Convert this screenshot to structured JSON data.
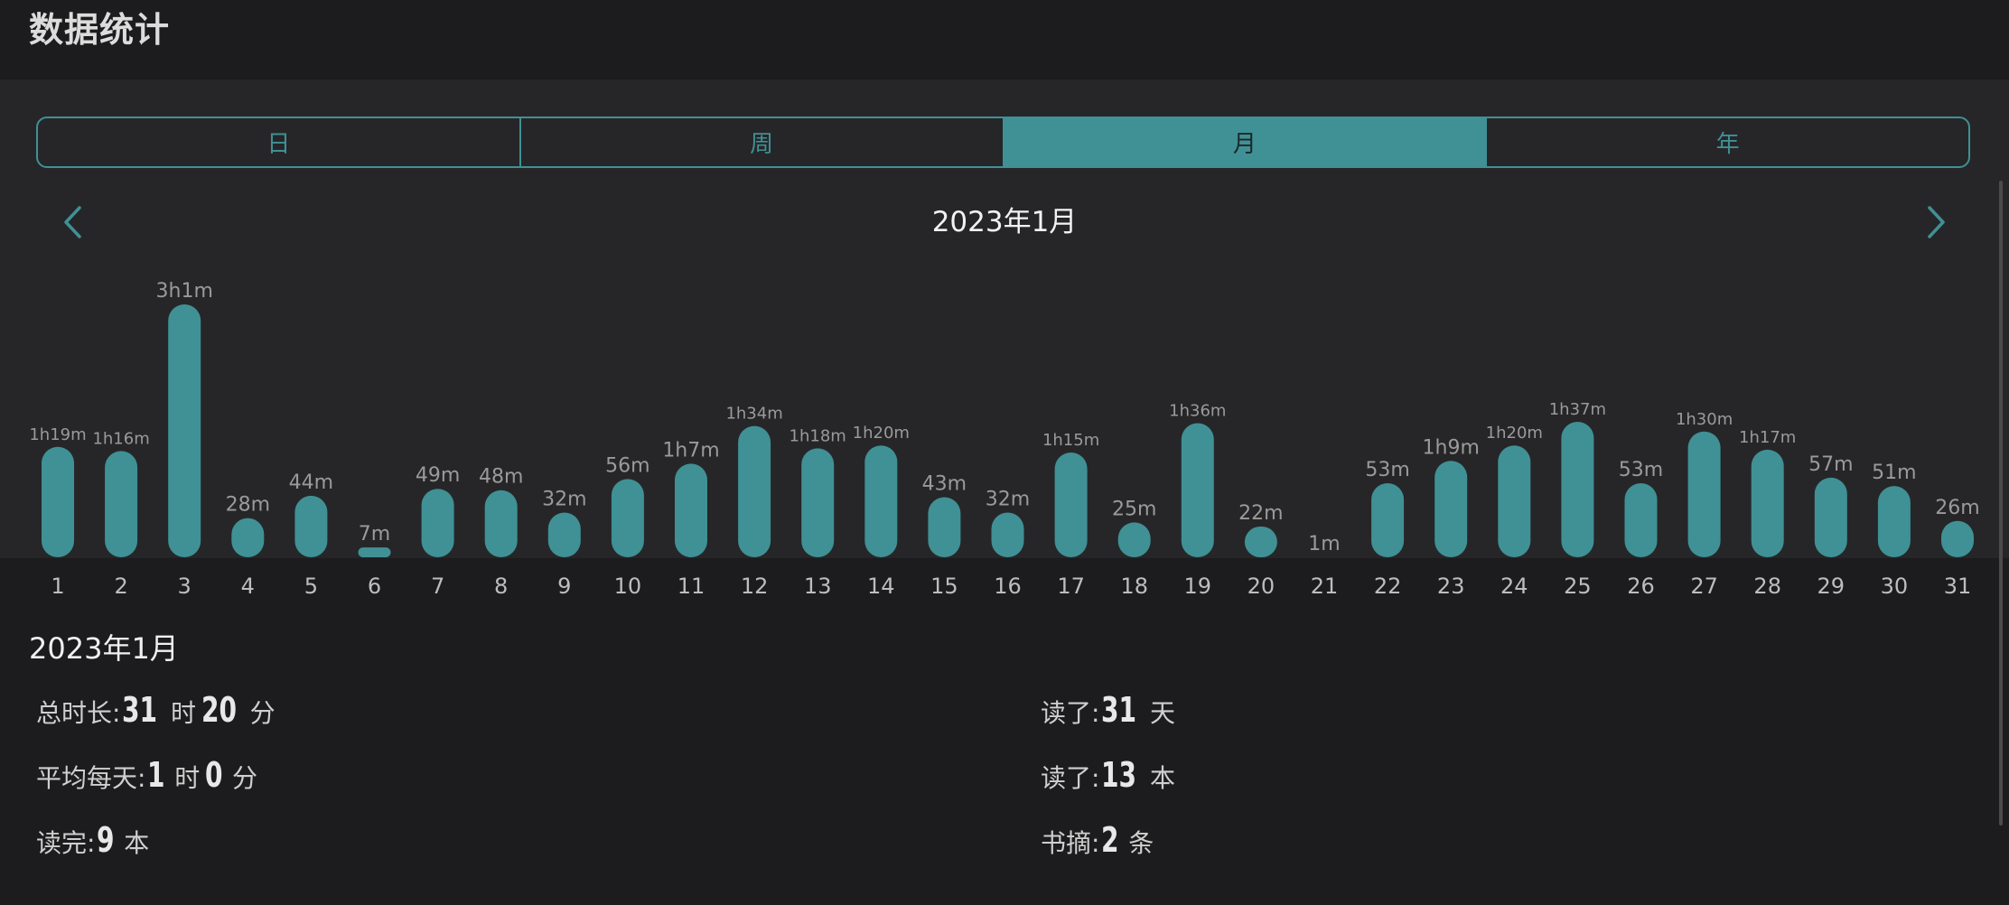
{
  "page_title": "数据统计",
  "tabs": [
    {
      "label": "日",
      "active": false
    },
    {
      "label": "周",
      "active": false
    },
    {
      "label": "月",
      "active": true
    },
    {
      "label": "年",
      "active": false
    }
  ],
  "period_label": "2023年1月",
  "nav": {
    "prev_icon": "chevron-left-icon",
    "next_icon": "chevron-right-icon"
  },
  "colors": {
    "accent": "#3f9195",
    "bar": "#3f9195",
    "background": "#1c1c1e",
    "panel": "#262628"
  },
  "chart_data": {
    "type": "bar",
    "categories": [
      "1",
      "2",
      "3",
      "4",
      "5",
      "6",
      "7",
      "8",
      "9",
      "10",
      "11",
      "12",
      "13",
      "14",
      "15",
      "16",
      "17",
      "18",
      "19",
      "20",
      "21",
      "22",
      "23",
      "24",
      "25",
      "26",
      "27",
      "28",
      "29",
      "30",
      "31"
    ],
    "values_minutes": [
      79,
      76,
      181,
      28,
      44,
      7,
      49,
      48,
      32,
      56,
      67,
      94,
      78,
      80,
      43,
      32,
      75,
      25,
      96,
      22,
      1,
      53,
      69,
      80,
      97,
      53,
      90,
      77,
      57,
      51,
      26
    ],
    "data_labels": [
      "1h19m",
      "1h16m",
      "3h1m",
      "28m",
      "44m",
      "7m",
      "49m",
      "48m",
      "32m",
      "56m",
      "1h7m",
      "1h34m",
      "1h18m",
      "1h20m",
      "43m",
      "32m",
      "1h15m",
      "25m",
      "1h36m",
      "22m",
      "1m",
      "53m",
      "1h9m",
      "1h20m",
      "1h37m",
      "53m",
      "1h30m",
      "1h17m",
      "57m",
      "51m",
      "26m"
    ]
  },
  "summary": {
    "title": "2023年1月",
    "total": {
      "label": "总时长:",
      "hours": "31",
      "hours_unit": "时",
      "minutes": "20",
      "minutes_unit": "分"
    },
    "daily_avg": {
      "label": "平均每天:",
      "hours": "1",
      "hours_unit": "时",
      "minutes": "0",
      "minutes_unit": "分"
    },
    "finished": {
      "label": "读完:",
      "value": "9",
      "unit": "本"
    },
    "days_read": {
      "label": "读了:",
      "value": "31",
      "unit": "天"
    },
    "books_read": {
      "label": "读了:",
      "value": "13",
      "unit": "本"
    },
    "excerpts": {
      "label": "书摘:",
      "value": "2",
      "unit": "条"
    }
  }
}
